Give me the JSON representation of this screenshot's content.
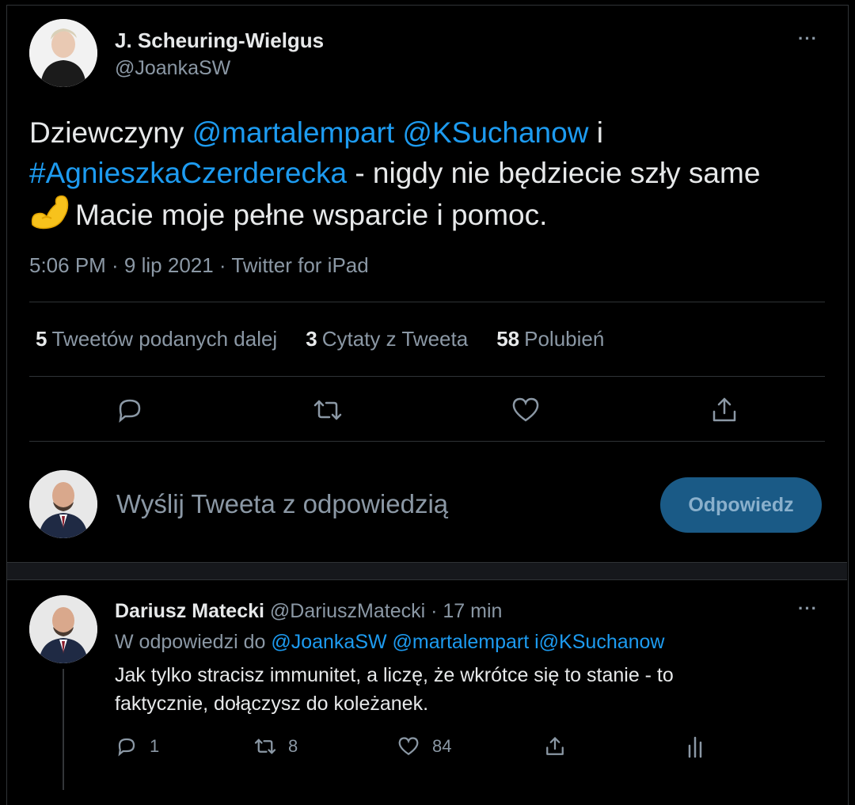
{
  "tweet": {
    "author_name": "J. Scheuring-Wielgus",
    "author_handle": "@JoankaSW",
    "text": {
      "line1_a": "Dziewczyny ",
      "mention1": "@martalempart",
      "space": " ",
      "mention2": "@KSuchanow",
      "line1_b": " i",
      "hashtag": "#AgnieszkaCzerderecka",
      "line2_b": " - nigdy nie będziecie szły same",
      "emoji": "💪",
      "line3": "Macie moje pełne wsparcie i pomoc."
    },
    "timestamp": "5:06 PM · 9 lip 2021 · Twitter for iPad",
    "stats": [
      {
        "count": "5",
        "label": "Tweetów podanych dalej"
      },
      {
        "count": "3",
        "label": "Cytaty z Tweeta"
      },
      {
        "count": "58",
        "label": "Polubień"
      }
    ],
    "more_icon": "···"
  },
  "compose": {
    "placeholder": "Wyślij Tweeta z odpowiedzią",
    "button_label": "Odpowiedz"
  },
  "reply": {
    "author_name": "Dariusz Matecki",
    "author_handle": "@DariuszMatecki",
    "time": " · 17 min",
    "replying_prefix": "W odpowiedzi do ",
    "replying_to": "@JoankaSW @martalempart i@KSuchanow",
    "text": "Jak tylko stracisz immunitet, a liczę, że wkrótce się to stanie - to faktycznie, dołączysz do koleżanek.",
    "counts": {
      "replies": "1",
      "retweets": "8",
      "likes": "84"
    },
    "more_icon": "···"
  },
  "colors": {
    "accent": "#1d9bf0",
    "background": "#000000",
    "muted": "#8b98a5"
  }
}
